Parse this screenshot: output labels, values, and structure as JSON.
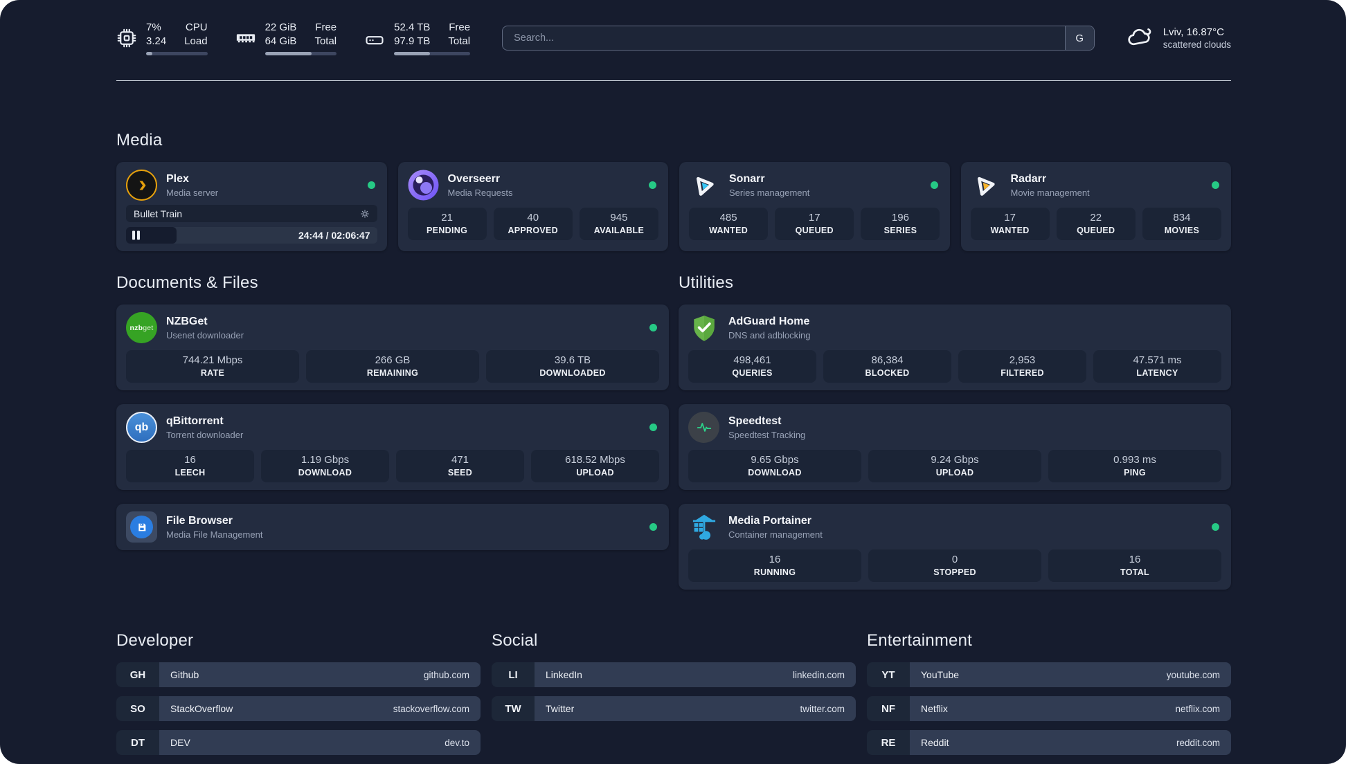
{
  "header": {
    "stats": [
      {
        "icon": "cpu-icon",
        "value1": "7%",
        "value2": "3.24",
        "label1": "CPU",
        "label2": "Load",
        "progress": 10
      },
      {
        "icon": "ram-icon",
        "value1": "22 GiB",
        "value2": "64 GiB",
        "label1": "Free",
        "label2": "Total",
        "progress": 65
      },
      {
        "icon": "disk-icon",
        "value1": "52.4 TB",
        "value2": "97.9 TB",
        "label1": "Free",
        "label2": "Total",
        "progress": 47
      }
    ],
    "search": {
      "placeholder": "Search...",
      "button_label": "G"
    },
    "weather": {
      "line1": "Lviv, 16.87°C",
      "line2": "scattered clouds"
    }
  },
  "media": {
    "title": "Media",
    "plex": {
      "name": "Plex",
      "description": "Media server",
      "online": true,
      "now_playing": {
        "title": "Bullet Train",
        "elapsed": "24:44",
        "duration": "02:06:47",
        "time_display": "24:44 / 02:06:47",
        "progress": 20
      }
    },
    "overseerr": {
      "name": "Overseerr",
      "description": "Media Requests",
      "stats": [
        {
          "value": "21",
          "label": "PENDING"
        },
        {
          "value": "40",
          "label": "APPROVED"
        },
        {
          "value": "945",
          "label": "AVAILABLE"
        }
      ]
    },
    "sonarr": {
      "name": "Sonarr",
      "description": "Series management",
      "stats": [
        {
          "value": "485",
          "label": "WANTED"
        },
        {
          "value": "17",
          "label": "QUEUED"
        },
        {
          "value": "196",
          "label": "SERIES"
        }
      ]
    },
    "radarr": {
      "name": "Radarr",
      "description": "Movie management",
      "stats": [
        {
          "value": "17",
          "label": "WANTED"
        },
        {
          "value": "22",
          "label": "QUEUED"
        },
        {
          "value": "834",
          "label": "MOVIES"
        }
      ]
    }
  },
  "documents": {
    "title": "Documents & Files",
    "nzbget": {
      "name": "NZBGet",
      "description": "Usenet downloader",
      "icon_text_bold": "nzb",
      "icon_text_light": "get",
      "stats": [
        {
          "value": "744.21 Mbps",
          "label": "RATE"
        },
        {
          "value": "266 GB",
          "label": "REMAINING"
        },
        {
          "value": "39.6 TB",
          "label": "DOWNLOADED"
        }
      ]
    },
    "qbittorrent": {
      "name": "qBittorrent",
      "description": "Torrent downloader",
      "icon_text": "qb",
      "stats": [
        {
          "value": "16",
          "label": "LEECH"
        },
        {
          "value": "1.19 Gbps",
          "label": "DOWNLOAD"
        },
        {
          "value": "471",
          "label": "SEED"
        },
        {
          "value": "618.52 Mbps",
          "label": "UPLOAD"
        }
      ]
    },
    "filebrowser": {
      "name": "File Browser",
      "description": "Media File Management"
    }
  },
  "utilities": {
    "title": "Utilities",
    "adguard": {
      "name": "AdGuard Home",
      "description": "DNS and adblocking",
      "stats": [
        {
          "value": "498,461",
          "label": "QUERIES"
        },
        {
          "value": "86,384",
          "label": "BLOCKED"
        },
        {
          "value": "2,953",
          "label": "FILTERED"
        },
        {
          "value": "47.571 ms",
          "label": "LATENCY"
        }
      ]
    },
    "speedtest": {
      "name": "Speedtest",
      "description": "Speedtest Tracking",
      "stats": [
        {
          "value": "9.65 Gbps",
          "label": "DOWNLOAD"
        },
        {
          "value": "9.24 Gbps",
          "label": "UPLOAD"
        },
        {
          "value": "0.993 ms",
          "label": "PING"
        }
      ]
    },
    "portainer": {
      "name": "Media Portainer",
      "description": "Container management",
      "stats": [
        {
          "value": "16",
          "label": "RUNNING"
        },
        {
          "value": "0",
          "label": "STOPPED"
        },
        {
          "value": "16",
          "label": "TOTAL"
        }
      ]
    }
  },
  "bookmarks": {
    "developer": {
      "title": "Developer",
      "items": [
        {
          "abbr": "GH",
          "name": "Github",
          "url": "github.com"
        },
        {
          "abbr": "SO",
          "name": "StackOverflow",
          "url": "stackoverflow.com"
        },
        {
          "abbr": "DT",
          "name": "DEV",
          "url": "dev.to"
        }
      ]
    },
    "social": {
      "title": "Social",
      "items": [
        {
          "abbr": "LI",
          "name": "LinkedIn",
          "url": "linkedin.com"
        },
        {
          "abbr": "TW",
          "name": "Twitter",
          "url": "twitter.com"
        }
      ]
    },
    "entertainment": {
      "title": "Entertainment",
      "items": [
        {
          "abbr": "YT",
          "name": "YouTube",
          "url": "youtube.com"
        },
        {
          "abbr": "NF",
          "name": "Netflix",
          "url": "netflix.com"
        },
        {
          "abbr": "RE",
          "name": "Reddit",
          "url": "reddit.com"
        }
      ]
    }
  },
  "colors": {
    "status_online": "#26c985",
    "plex_amber": "#e5a00d",
    "sonarr_cyan": "#35c5f4",
    "radarr_amber": "#f7b32b",
    "adguard_green": "#67b34a",
    "speedtest_green": "#2bd48a",
    "portainer_blue": "#2fa8e1"
  }
}
